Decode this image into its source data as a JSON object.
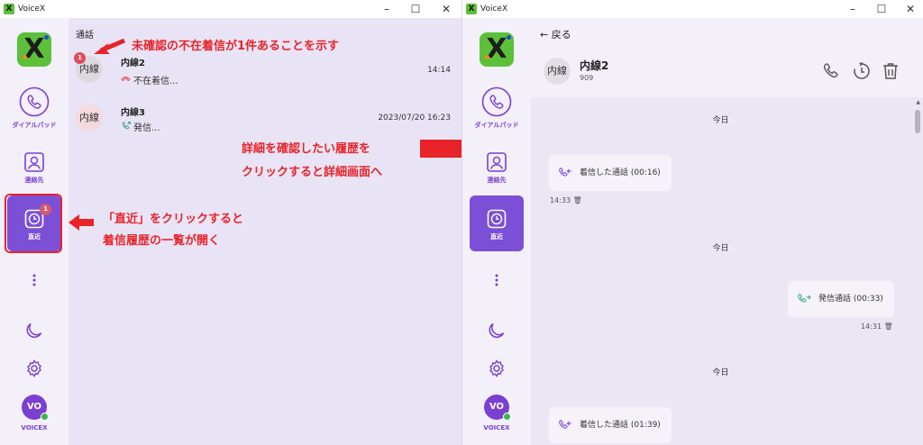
{
  "app": {
    "title": "VoiceX"
  },
  "sidebar": {
    "dialpad_label": "ダイアルパッド",
    "contacts_label": "連絡先",
    "recent_label": "直近",
    "recent_badge": "1",
    "user_initials": "VO",
    "user_label": "VOICEX"
  },
  "call_list": {
    "header": "通話",
    "items": [
      {
        "avatar": "内線",
        "name": "内線2",
        "status": "不在着信...",
        "time": "14:14",
        "badge": "1"
      },
      {
        "avatar": "内線",
        "name": "内線3",
        "status": "発信...",
        "time": "2023/07/20 16:23"
      }
    ]
  },
  "detail": {
    "back_label": "戻る",
    "avatar": "内線",
    "name": "内線2",
    "number": "909",
    "entries": [
      {
        "day": "今日",
        "text": "着信した通話 (00:16)",
        "time": "14:33",
        "direction": "incoming"
      },
      {
        "day": "今日",
        "text": "発信通話 (00:33)",
        "time": "14:31",
        "direction": "outgoing"
      },
      {
        "day": "今日",
        "text": "着信した通話 (01:39)",
        "direction": "incoming"
      }
    ]
  },
  "annotations": {
    "missed": "未確認の不在着信が1件あることを示す",
    "recent_line1": "「直近」をクリックすると",
    "recent_line2": "着信履歴の一覧が開く",
    "detail_line1": "詳細を確認したい履歴を",
    "detail_line2": "クリックすると詳細画面へ"
  },
  "colors": {
    "accent": "#7b3fd1",
    "brand_green": "#5cc03a",
    "annotation_red": "#e8232a",
    "badge": "#e04a5c"
  }
}
